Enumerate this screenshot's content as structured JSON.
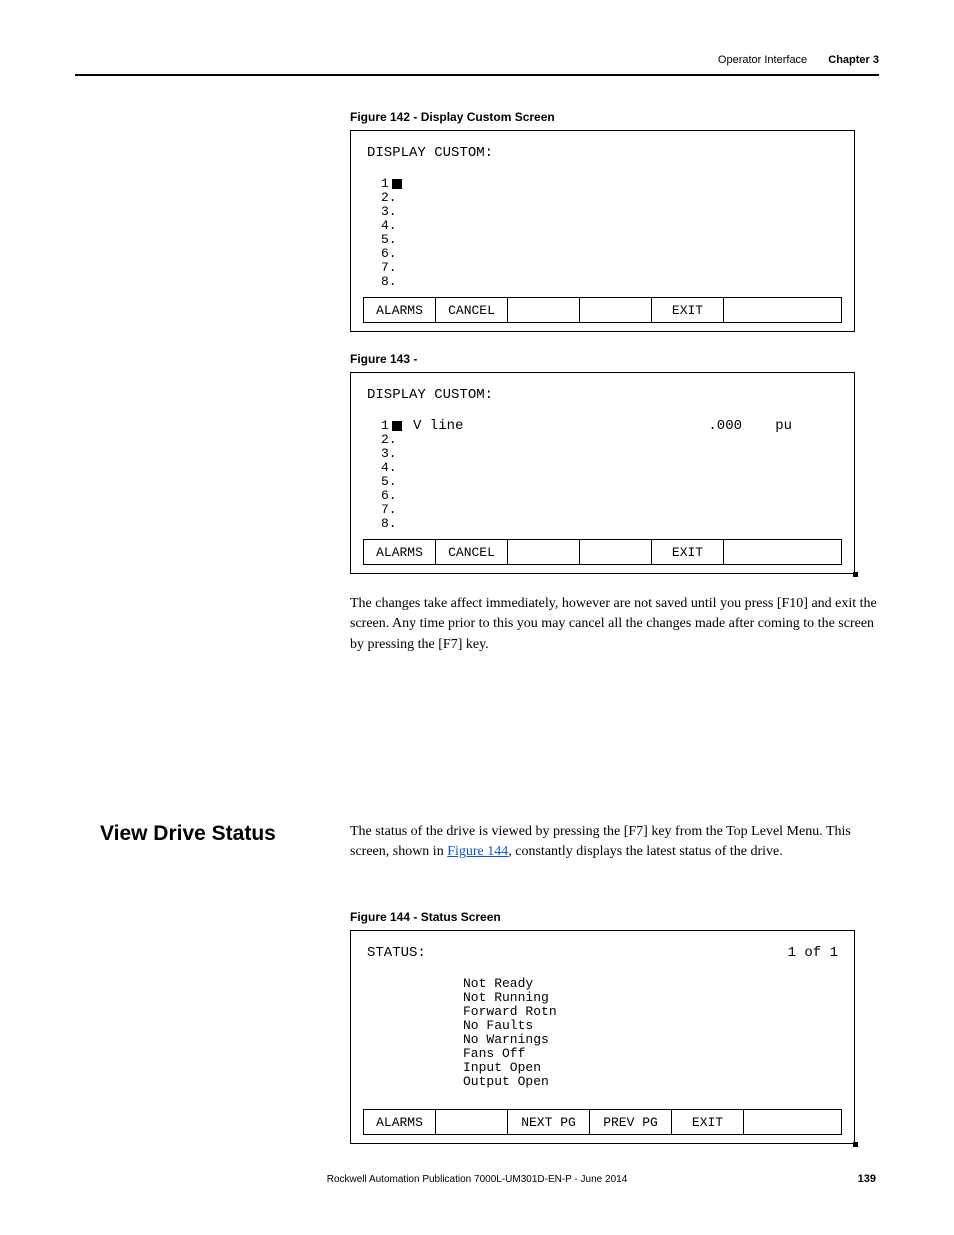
{
  "header": {
    "section": "Operator Interface",
    "chapter": "Chapter 3"
  },
  "fig142": {
    "caption": "Figure 142 - Display Custom Screen",
    "title": "DISPLAY CUSTOM:",
    "nums": [
      "1",
      "2.",
      "3.",
      "4.",
      "5.",
      "6.",
      "7.",
      "8."
    ],
    "buttons": {
      "alarms": "ALARMS",
      "cancel": "CANCEL",
      "exit": "EXIT"
    }
  },
  "fig143": {
    "caption": "Figure 143 -",
    "title": "DISPLAY CUSTOM:",
    "nums": [
      "1",
      "2.",
      "3.",
      "4.",
      "5.",
      "6.",
      "7.",
      "8."
    ],
    "line1_label": "V line",
    "line1_value": ".000",
    "line1_unit": "pu",
    "buttons": {
      "alarms": "ALARMS",
      "cancel": "CANCEL",
      "exit": "EXIT"
    }
  },
  "para1": "The changes take affect immediately, however are not saved until you press [F10] and exit the screen. Any time prior to this you may cancel all the changes made after coming to the screen by pressing the [F7] key.",
  "section": {
    "heading": "View Drive Status",
    "text_a": "The status of the drive is viewed by pressing the [F7] key from the Top Level Menu. This screen, shown in ",
    "link": "Figure 144",
    "text_b": ", constantly displays the latest status of the drive."
  },
  "fig144": {
    "caption": "Figure 144 - Status Screen",
    "title": "STATUS:",
    "pageinfo": "1 of  1",
    "status_lines": [
      "Not Ready",
      "Not Running",
      "Forward Rotn",
      "No Faults",
      "No Warnings",
      "Fans Off",
      "Input Open",
      "Output Open"
    ],
    "buttons": {
      "alarms": "ALARMS",
      "nextpg": "NEXT PG",
      "prevpg": "PREV PG",
      "exit": "EXIT"
    }
  },
  "footer": "Rockwell Automation Publication 7000L-UM301D-EN-P - June 2014",
  "page_num": "139"
}
